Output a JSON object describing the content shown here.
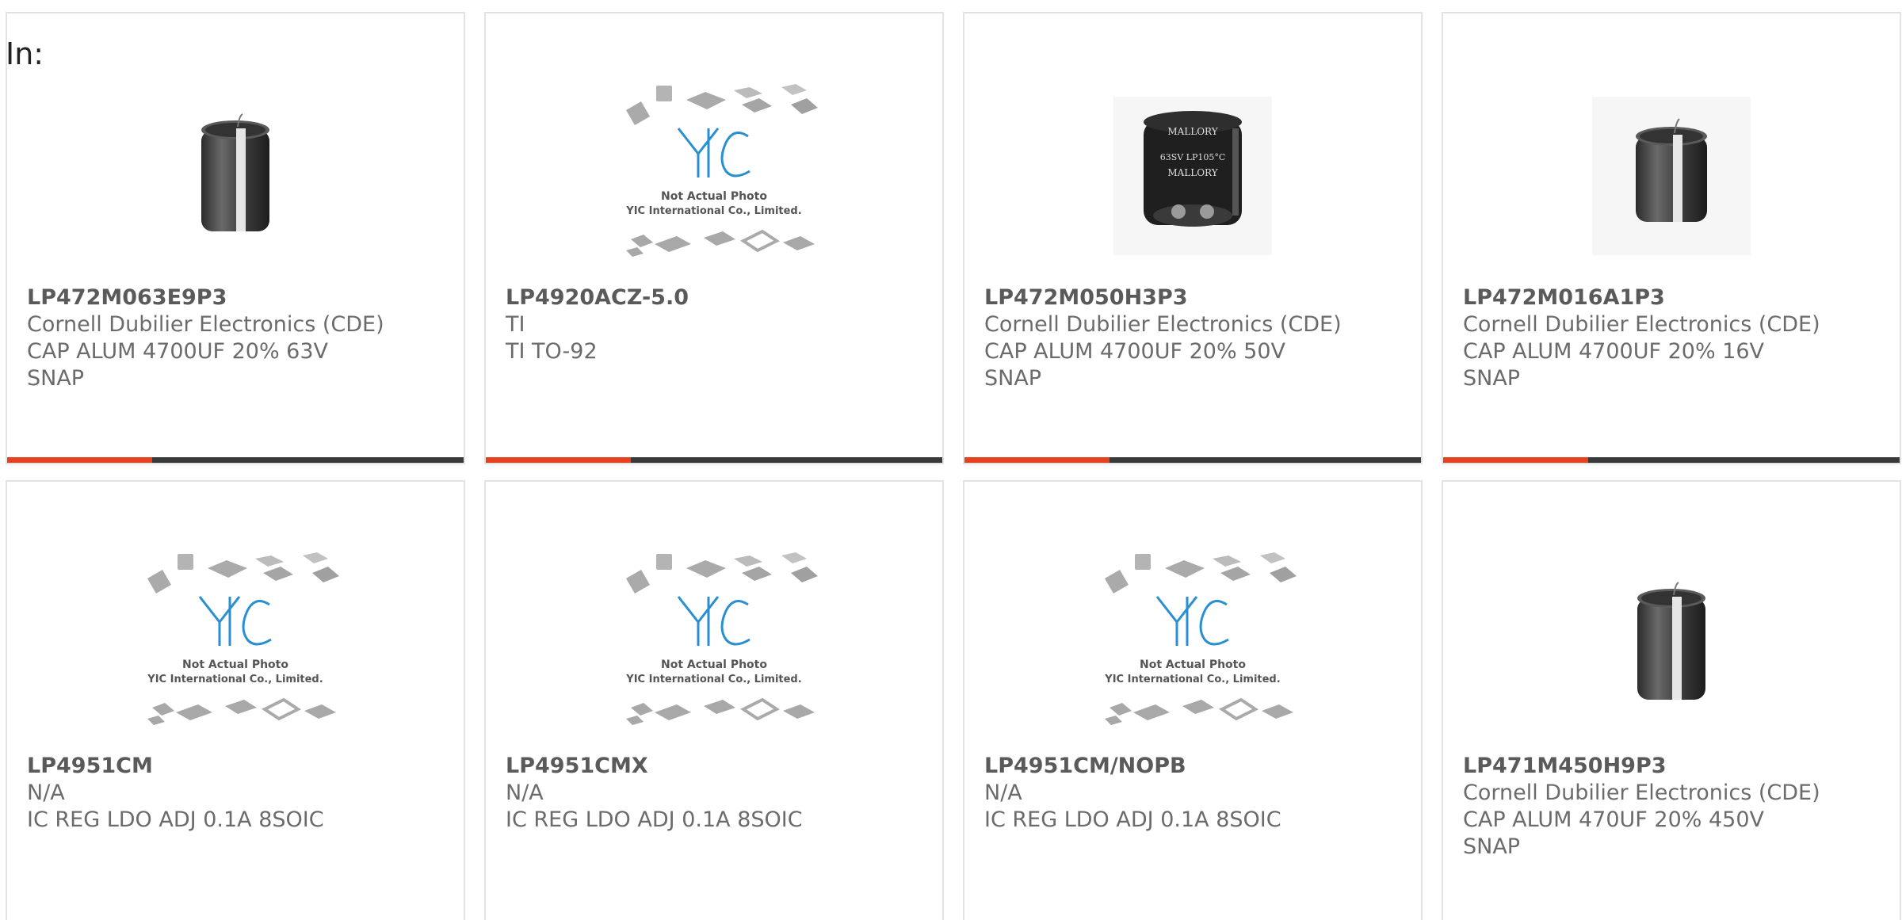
{
  "search_prefix": "In:",
  "placeholder_photo": {
    "line1": "Not Actual Photo",
    "line2": "YIC International Co., Limited."
  },
  "colors": {
    "accent": "#e8411e",
    "bar": "#3a3a3a",
    "yic_blue": "#2a8fd0"
  },
  "products": [
    {
      "part_number": "LP472M063E9P3",
      "manufacturer": "Cornell Dubilier Electronics (CDE)",
      "desc1": "CAP ALUM 4700UF 20% 63V",
      "desc2": "SNAP",
      "image": "capacitor-tall"
    },
    {
      "part_number": "LP4920ACZ-5.0",
      "manufacturer": "TI",
      "desc1": "TI TO-92",
      "desc2": "",
      "image": "yic-placeholder"
    },
    {
      "part_number": "LP472M050H3P3",
      "manufacturer": "Cornell Dubilier Electronics (CDE)",
      "desc1": "CAP ALUM 4700UF 20% 50V",
      "desc2": "SNAP",
      "image": "capacitor-mallory"
    },
    {
      "part_number": "LP472M016A1P3",
      "manufacturer": "Cornell Dubilier Electronics (CDE)",
      "desc1": "CAP ALUM 4700UF 20% 16V",
      "desc2": "SNAP",
      "image": "capacitor-short"
    },
    {
      "part_number": "LP4951CM",
      "manufacturer": "N/A",
      "desc1": "IC REG LDO ADJ 0.1A 8SOIC",
      "desc2": "",
      "image": "yic-placeholder"
    },
    {
      "part_number": "LP4951CMX",
      "manufacturer": "N/A",
      "desc1": "IC REG LDO ADJ 0.1A 8SOIC",
      "desc2": "",
      "image": "yic-placeholder"
    },
    {
      "part_number": "LP4951CM/NOPB",
      "manufacturer": "N/A",
      "desc1": "IC REG LDO ADJ 0.1A 8SOIC",
      "desc2": "",
      "image": "yic-placeholder"
    },
    {
      "part_number": "LP471M450H9P3",
      "manufacturer": "Cornell Dubilier Electronics (CDE)",
      "desc1": "CAP ALUM 470UF 20% 450V",
      "desc2": "SNAP",
      "image": "capacitor-tall"
    }
  ]
}
